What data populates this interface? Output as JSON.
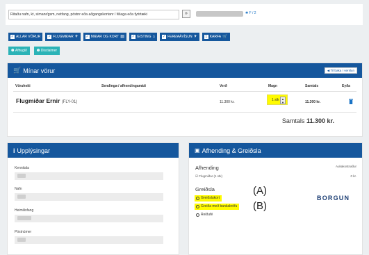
{
  "search": {
    "placeholder": "Ritaðu nafn, kt, símanr/gsm, netfang, póstnr eða aðgangskortanr í félaga eða fyrirtæki",
    "button": "»",
    "tag": "✱ F / 2"
  },
  "nav": [
    {
      "label": "ALLAR VÖRUR",
      "icon": ""
    },
    {
      "label": "FLUGMIÐAR",
      "icon": "✈"
    },
    {
      "label": "MIÐAR OG KORT",
      "icon": "▤"
    },
    {
      "label": "GISTING",
      "icon": "⌂"
    },
    {
      "label": "FERÐAÁVÍSUN",
      "icon": "✈"
    },
    {
      "label": "KARFA",
      "icon": "🛒",
      "count": "1"
    }
  ],
  "toolbar": [
    {
      "label": "Afhugið"
    },
    {
      "label": "Disclaimer"
    }
  ],
  "cart": {
    "title": "Mínar vörur",
    "back_label": "◀ Til baka í verslun",
    "columns": {
      "item": "Vöruheiti",
      "shipping": "Sendinga-/ afhendingamáti",
      "price": "Verð",
      "qty": "Magn",
      "total": "Samtals",
      "delete": "Eyða"
    },
    "item": {
      "name": "Flugmiðar Ernir",
      "code": "(FLY-01)",
      "price": "11.300 kr.",
      "qty": "1 stk",
      "total": "11.300 kr."
    },
    "total_label": "Samtals",
    "total_value": "11.300 kr."
  },
  "info": {
    "title": "Upplýsingar",
    "fields": [
      "Kennitala",
      "Nafn",
      "Heimilisfang",
      "Póstnúmer"
    ]
  },
  "delivery": {
    "title": "Afhending & Greiðsla",
    "afhending_title": "Afhending",
    "afhending_note": "Aukakostnaður",
    "afhending_item": "Flugmiðar (1 stk)",
    "afhending_price": "0 kr.",
    "payment_title": "Greiðsla",
    "options": [
      {
        "label": "Greiðslukort",
        "highlight": true
      },
      {
        "label": "Greiða með bankakröfu",
        "highlight": true
      },
      {
        "label": "Reiðufé",
        "highlight": false
      }
    ],
    "brand": "BORGUN"
  },
  "annotations": {
    "a": "(A)",
    "b": "(B)"
  }
}
